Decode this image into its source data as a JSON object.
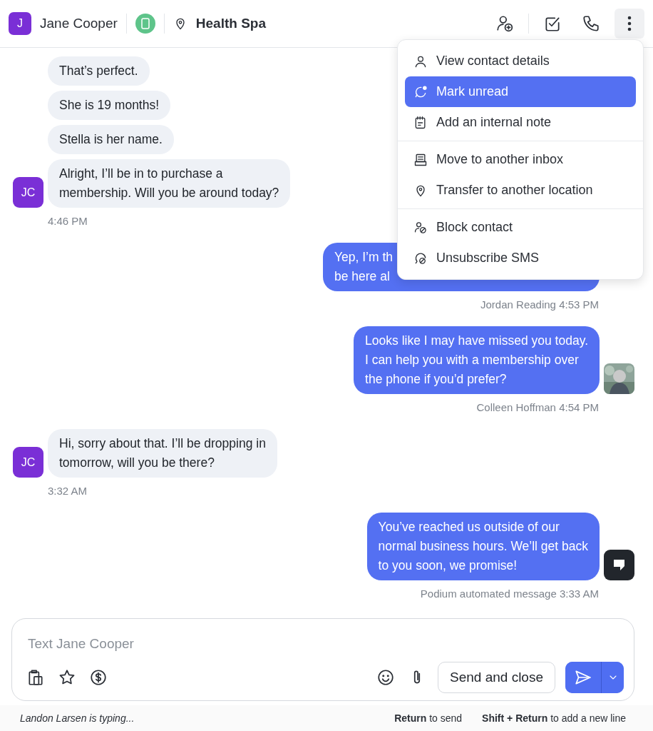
{
  "header": {
    "avatar_initial": "J",
    "contact_name": "Jane Cooper",
    "location": "Health Spa"
  },
  "messages": [
    {
      "kind": "incoming",
      "bubbles": [
        [
          "That’s perfect."
        ],
        [
          "She is 19 months!"
        ],
        [
          "Stella is her name."
        ],
        [
          "Alright, I’ll be in to purchase a",
          "membership. Will you be around today?"
        ]
      ],
      "avatar": {
        "kind": "initials",
        "text": "JC"
      },
      "meta": "4:46 PM"
    },
    {
      "kind": "outgoing",
      "bubbles": [
        [
          "Yep, I’m th",
          "be here al"
        ]
      ],
      "sender": "Jordan Reading",
      "time": "4:53 PM"
    },
    {
      "kind": "outgoing",
      "bubbles": [
        [
          "Looks like I may have missed you today.",
          "I can help you with a membership over",
          "the phone if you’d prefer?"
        ]
      ],
      "sender": "Colleen Hoffman",
      "time": "4:54 PM",
      "avatar": {
        "kind": "picture"
      }
    },
    {
      "kind": "incoming",
      "bubbles": [
        [
          "Hi, sorry about that. I’ll be dropping in",
          "tomorrow, will you be there?"
        ]
      ],
      "avatar": {
        "kind": "initials",
        "text": "JC"
      },
      "meta": "3:32 AM"
    },
    {
      "kind": "outgoing",
      "bubbles": [
        [
          "You’ve reached us outside of our",
          "normal business hours. We’ll get back",
          "to you soon, we promise!"
        ]
      ],
      "sender": "Podium automated message",
      "time": "3:33 AM",
      "avatar": {
        "kind": "logo"
      }
    }
  ],
  "menu": {
    "groups": [
      [
        {
          "label": "View contact details",
          "kind": "person",
          "selected": false
        },
        {
          "label": "Mark unread",
          "kind": "unread",
          "selected": true
        },
        {
          "label": "Add an internal note",
          "kind": "note",
          "selected": false
        }
      ],
      [
        {
          "label": "Move to another inbox",
          "kind": "inbox",
          "selected": false
        },
        {
          "label": "Transfer to another location",
          "kind": "location",
          "selected": false
        }
      ],
      [
        {
          "label": "Block contact",
          "kind": "block",
          "selected": false
        },
        {
          "label": "Unsubscribe SMS",
          "kind": "unsubscribe",
          "selected": false
        }
      ]
    ]
  },
  "composer": {
    "placeholder": "Text Jane Cooper",
    "send_button": "Send and close"
  },
  "footer": {
    "typing": "Landon Larsen is typing...",
    "hint_send": "**Return** to send",
    "hint_newline": "**Shift + Return** to add a new line"
  }
}
